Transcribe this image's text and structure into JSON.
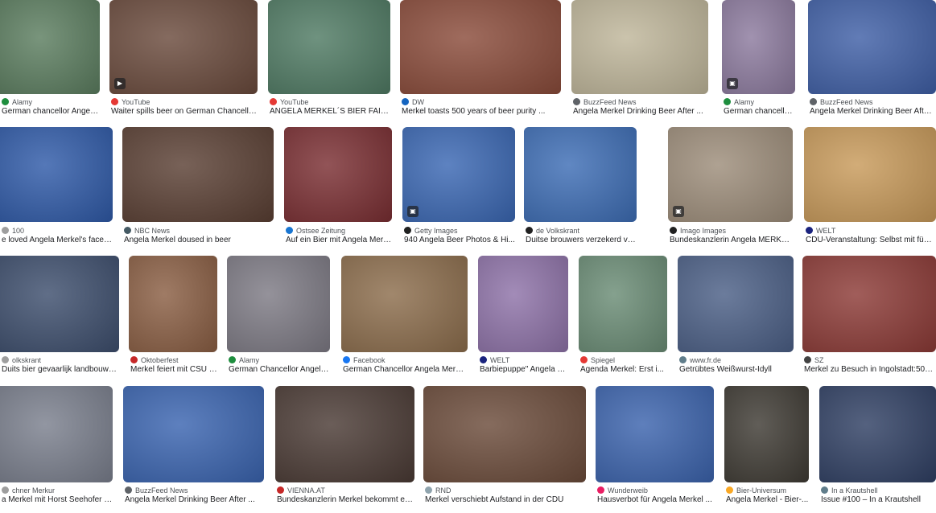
{
  "results": [
    {
      "source": "Alamy",
      "title": "German chancellor Angela Merk...",
      "thumb": "#5b7d5f",
      "fav": "#1e8e3e",
      "badge": "",
      "clip": true
    },
    {
      "source": "YouTube",
      "title": "Waiter spills beer on German Chancellor...",
      "thumb": "#6a4a3c",
      "fav": "#e53935",
      "badge": "play"
    },
    {
      "source": "YouTube",
      "title": "ANGELA MERKEL´S BIER FAIL - ...",
      "thumb": "#4f7a63",
      "fav": "#e53935",
      "badge": ""
    },
    {
      "source": "DW",
      "title": "Merkel toasts 500 years of beer purity ...",
      "thumb": "#8a4b3a",
      "fav": "#1565c0",
      "badge": ""
    },
    {
      "source": "BuzzFeed News",
      "title": "Angela Merkel Drinking Beer After ...",
      "thumb": "#bfb69a",
      "fav": "#5f6368",
      "badge": ""
    },
    {
      "source": "Alamy",
      "title": "German chancellor ...",
      "thumb": "#8c7a9e",
      "fav": "#1e8e3e",
      "badge": "img"
    },
    {
      "source": "BuzzFeed News",
      "title": "Angela Merkel Drinking Beer After ...",
      "thumb": "#3f5fa6",
      "fav": "#5f6368",
      "badge": ""
    },
    {
      "source": "100",
      "title": "e loved Angela Merkel's face af...",
      "thumb": "#2f5aa8",
      "fav": "#9e9e9e",
      "badge": "",
      "clip": true
    },
    {
      "source": "NBC News",
      "title": "Angela Merkel doused in beer",
      "thumb": "#5a3f33",
      "fav": "#455a64",
      "badge": ""
    },
    {
      "source": "Ostsee Zeitung",
      "title": "Auf ein Bier mit Angela Merk...",
      "thumb": "#7a2e32",
      "fav": "#1976d2",
      "badge": ""
    },
    {
      "source": "Getty Images",
      "title": "940 Angela Beer Photos & Hi...",
      "thumb": "#3a67b3",
      "fav": "#212121",
      "badge": "img"
    },
    {
      "source": "de Volkskrant",
      "title": "Duitse brouwers verzekerd van ...",
      "thumb": "#3d6db5",
      "fav": "#212121",
      "badge": ""
    },
    {
      "source": "Imago Images",
      "title": "Bundeskanzlerin Angela MERKEL ...",
      "thumb": "#9d8d7a",
      "fav": "#212121",
      "badge": "img"
    },
    {
      "source": "WELT",
      "title": "CDU-Veranstaltung: Selbst mit fünf Bie...",
      "thumb": "#c89a5a",
      "fav": "#1a237e",
      "badge": ""
    },
    {
      "source": "olkskrant",
      "title": "Duits bier gevaarlijk landbouwgi...",
      "thumb": "#3d4e6d",
      "fav": "#9e9e9e",
      "badge": "",
      "clip": true
    },
    {
      "source": "Oktoberfest",
      "title": "Merkel feiert mit CSU i...",
      "thumb": "#8a5e43",
      "fav": "#c62828",
      "badge": ""
    },
    {
      "source": "Alamy",
      "title": "German Chancellor Angela ...",
      "thumb": "#7d7a84",
      "fav": "#1e8e3e",
      "badge": ""
    },
    {
      "source": "Facebook",
      "title": "German Chancellor Angela Merkel...",
      "thumb": "#8c6d4c",
      "fav": "#1877f2",
      "badge": ""
    },
    {
      "source": "WELT",
      "title": "Barbiepuppe\" Angela M...",
      "thumb": "#8e72a8",
      "fav": "#1a237e",
      "badge": ""
    },
    {
      "source": "Spiegel",
      "title": "Agenda Merkel: Erst i...",
      "thumb": "#6a8c75",
      "fav": "#e53935",
      "badge": ""
    },
    {
      "source": "www.fr.de",
      "title": "Getrübtes Weißwurst-Idyll",
      "thumb": "#4b5f86",
      "fav": "#607d8b",
      "badge": ""
    },
    {
      "source": "SZ",
      "title": "Merkel zu Besuch in Ingolstadt:500 ...",
      "thumb": "#8c3a36",
      "fav": "#424242",
      "badge": ""
    },
    {
      "source": "chner Merkur",
      "title": "a Merkel mit Horst Seehofer im...",
      "thumb": "#7a7f8d",
      "fav": "#9e9e9e",
      "badge": "",
      "clip": true
    },
    {
      "source": "BuzzFeed News",
      "title": "Angela Merkel Drinking Beer After ...",
      "thumb": "#3a64b0",
      "fav": "#5f6368",
      "badge": ""
    },
    {
      "source": "VIENNA.AT",
      "title": "Bundeskanzlerin Merkel bekommt ein...",
      "thumb": "#4a3a34",
      "fav": "#c62828",
      "badge": ""
    },
    {
      "source": "RND",
      "title": "Merkel verschiebt Aufstand in der CDU",
      "thumb": "#6b4b3a",
      "fav": "#90a4ae",
      "badge": ""
    },
    {
      "source": "Wunderweib",
      "title": "Hausverbot für Angela Merkel ...",
      "thumb": "#3b63ad",
      "fav": "#e91e63",
      "badge": ""
    },
    {
      "source": "Bier-Universum",
      "title": "Angela Merkel - Bier-...",
      "thumb": "#3e3a33",
      "fav": "#f9a825",
      "badge": ""
    },
    {
      "source": "In a Krautshell",
      "title": "Issue #100 – In a Krautshell",
      "thumb": "#2f3f63",
      "fav": "#607d8b",
      "badge": ""
    }
  ]
}
